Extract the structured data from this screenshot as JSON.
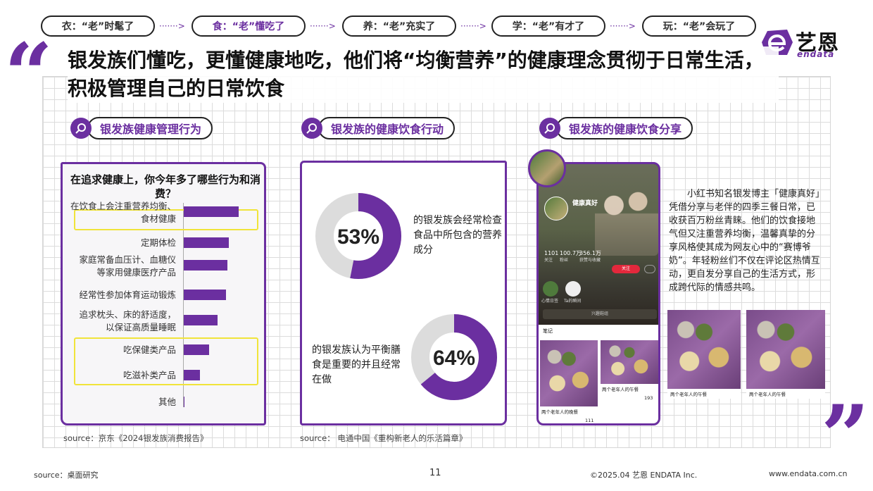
{
  "nav": {
    "items": [
      {
        "label": "衣：“老”时髦了",
        "active": false
      },
      {
        "label": "食：“老”懂吃了",
        "active": true
      },
      {
        "label": "养：“老”充实了",
        "active": false
      },
      {
        "label": "学：“老”有才了",
        "active": false
      },
      {
        "label": "玩：“老”会玩了",
        "active": false
      }
    ],
    "arrow": "·······>"
  },
  "logo": {
    "cn": "艺恩",
    "en": "endata"
  },
  "headline": "银发族们懂吃，更懂健康地吃，他们将“均衡营养”的健康理念贯彻于日常生活，积极管理自己的日常饮食",
  "quotes": {
    "open": "“",
    "close": "”"
  },
  "sections": {
    "s1": {
      "tag": "银发族健康管理行为",
      "chart_title": "在追求健康上，你今年多了哪些行为和消费？",
      "source": "source：京东《2024银发族消费报告》"
    },
    "s2": {
      "tag": "银发族的健康饮食行动",
      "donut1": {
        "value": "53%",
        "text": "的银发族会经常检查食品中所包含的营养成分"
      },
      "donut2": {
        "value": "64%",
        "text": "的银发族认为平衡膳食是重要的并且经常在做"
      },
      "source": "source：  电通中国《重构新老人的乐活篇章》"
    },
    "s3": {
      "tag": "银发族的健康饮食分享",
      "description": "小红书知名银发博主「健康真好」凭借分享与老伴的四季三餐日常，已收获百万粉丝青睐。他们的饮食接地气但又注重营养均衡，温馨真挚的分享风格使其成为网友心中的“赛博爷奶”。年轻粉丝们不仅在评论区热情互动，更自发分享自己的生活方式，形成跨代际的情感共鸣。",
      "phone": {
        "username": "健康真好",
        "stats": [
          "1101",
          "100.7万",
          "356.1万"
        ],
        "stat_labels": [
          "关注",
          "粉丝",
          "获赞与收藏"
        ],
        "follow": "关注",
        "feed_tab": "笔记",
        "group_bar": "兴趣鞋组",
        "circles": [
          "心情日签",
          "Ta的瞬间"
        ],
        "post1": "两个老年人的晚餐",
        "post2": "两个老年人的午餐",
        "likes": [
          "111",
          "193"
        ]
      },
      "photo_caption_1": "两个老年人的午餐",
      "photo_caption_2": "两个老年人的午餐"
    }
  },
  "chart_data": {
    "type": "bar",
    "orientation": "horizontal",
    "title": "在追求健康上，你今年多了哪些行为和消费？",
    "categories": [
      "在饮食上会注重营养均衡、食材健康",
      "定期体检",
      "家庭常备血压计、血糖仪等家用健康医疗产品",
      "经常性参加体育运动锻炼",
      "追求枕头、床的舒适度，以保证高质量睡眠",
      "吃保健类产品",
      "吃滋补类产品",
      "其他"
    ],
    "values": [
      78,
      64,
      62,
      60,
      48,
      36,
      23,
      1
    ],
    "value_unit": "relative bar length (no axis printed)",
    "highlighted": [
      "在饮食上会注重营养均衡、食材健康",
      "吃保健类产品",
      "吃滋补类产品"
    ],
    "colors": {
      "bar": "#6b2fa0",
      "highlight": "#f0e43a"
    }
  },
  "donuts": [
    {
      "value": 53,
      "color": "#6b2fa0",
      "track": "#dcdcdc"
    },
    {
      "value": 64,
      "color": "#6b2fa0",
      "track": "#dcdcdc"
    }
  ],
  "footer": {
    "source": "source：桌面研究",
    "page": "11",
    "copyright": "©2025.04  艺恩  ENDATA Inc.",
    "url": "www.endata.com.cn"
  }
}
